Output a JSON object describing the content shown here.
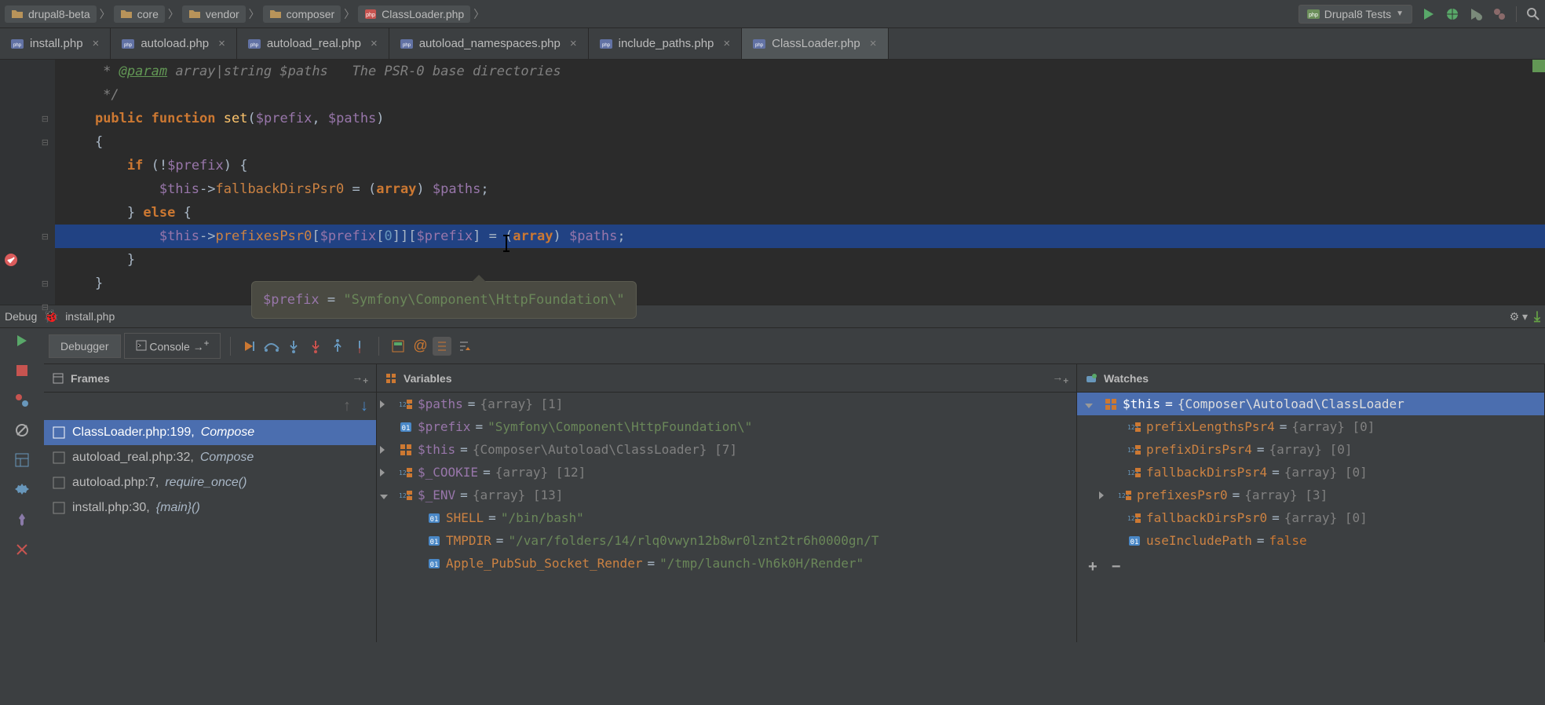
{
  "breadcrumbs": [
    {
      "icon": "folder",
      "label": "drupal8-beta"
    },
    {
      "icon": "folder",
      "label": "core"
    },
    {
      "icon": "folder",
      "label": "vendor"
    },
    {
      "icon": "folder",
      "label": "composer"
    },
    {
      "icon": "php",
      "label": "ClassLoader.php"
    }
  ],
  "run_config": {
    "label": "Drupal8 Tests"
  },
  "tabs": [
    {
      "label": "install.php",
      "active": false
    },
    {
      "label": "autoload.php",
      "active": false
    },
    {
      "label": "autoload_real.php",
      "active": false
    },
    {
      "label": "autoload_namespaces.php",
      "active": false
    },
    {
      "label": "include_paths.php",
      "active": false
    },
    {
      "label": "ClassLoader.php",
      "active": true
    }
  ],
  "code": {
    "l1": " * @param array|string $paths   The PSR-0 base directories",
    "l2": " */",
    "l3_kw1": "public",
    "l3_kw2": "function",
    "l3_fn": "set",
    "l3_p1": "$prefix",
    "l3_p2": "$paths",
    "l4": "{",
    "l5_kw": "if",
    "l5_v": "$prefix",
    "l6_t": "$this",
    "l6_p": "fallbackDirsPsr0",
    "l6_kw": "array",
    "l6_v": "$paths",
    "l7_kw": "else",
    "l8_t": "$this",
    "l8_p": "prefixesPsr0",
    "l8_v1": "$prefix",
    "l8_n": "0",
    "l8_v2": "$prefix",
    "l8_kw": "array",
    "l8_v3": "$paths",
    "l9": "}",
    "l10": "}"
  },
  "tooltip": {
    "var": "$prefix",
    "val": "\"Symfony\\Component\\HttpFoundation\\\""
  },
  "debug": {
    "title": "Debug",
    "target": "install.php"
  },
  "debugger_tabs": {
    "debugger": "Debugger",
    "console": "Console"
  },
  "panels": {
    "frames": "Frames",
    "variables": "Variables",
    "watches": "Watches"
  },
  "frames": [
    {
      "file": "ClassLoader.php",
      "line": "199",
      "fn": "Compose",
      "sel": true
    },
    {
      "file": "autoload_real.php",
      "line": "32",
      "fn": "Compose",
      "sel": false
    },
    {
      "file": "autoload.php",
      "line": "7",
      "fn": "require_once()",
      "sel": false
    },
    {
      "file": "install.php",
      "line": "30",
      "fn": "{main}()",
      "sel": false
    }
  ],
  "variables": [
    {
      "kind": "arr",
      "arrow": "r",
      "icon": "arr",
      "name": "$paths",
      "val": "{array} [1]"
    },
    {
      "kind": "str",
      "arrow": "",
      "icon": "str",
      "name": "$prefix",
      "val": "\"Symfony\\Component\\HttpFoundation\\\""
    },
    {
      "kind": "obj",
      "arrow": "r",
      "icon": "obj",
      "name": "$this",
      "val": "{Composer\\Autoload\\ClassLoader} [7]"
    },
    {
      "kind": "arr",
      "arrow": "r",
      "icon": "arr",
      "name": "$_COOKIE",
      "val": "{array} [12]"
    },
    {
      "kind": "arr",
      "arrow": "d",
      "icon": "arr",
      "name": "$_ENV",
      "val": "{array} [13]"
    }
  ],
  "env_children": [
    {
      "name": "SHELL",
      "val": "\"/bin/bash\""
    },
    {
      "name": "TMPDIR",
      "val": "\"/var/folders/14/rlq0vwyn12b8wr0lznt2tr6h0000gn/T"
    },
    {
      "name": "Apple_PubSub_Socket_Render",
      "val": "\"/tmp/launch-Vh6k0H/Render\""
    }
  ],
  "watches": {
    "root": {
      "name": "$this",
      "val": "{Composer\\Autoload\\ClassLoader"
    },
    "children": [
      {
        "name": "prefixLengthsPsr4",
        "val": "{array} [0]",
        "icon": "arr"
      },
      {
        "name": "prefixDirsPsr4",
        "val": "{array} [0]",
        "icon": "arr"
      },
      {
        "name": "fallbackDirsPsr4",
        "val": "{array} [0]",
        "icon": "arr"
      },
      {
        "name": "prefixesPsr0",
        "val": "{array} [3]",
        "icon": "arr",
        "arrow": "r"
      },
      {
        "name": "fallbackDirsPsr0",
        "val": "{array} [0]",
        "icon": "arr"
      },
      {
        "name": "useIncludePath",
        "val": "false",
        "icon": "str",
        "bool": true
      }
    ]
  }
}
